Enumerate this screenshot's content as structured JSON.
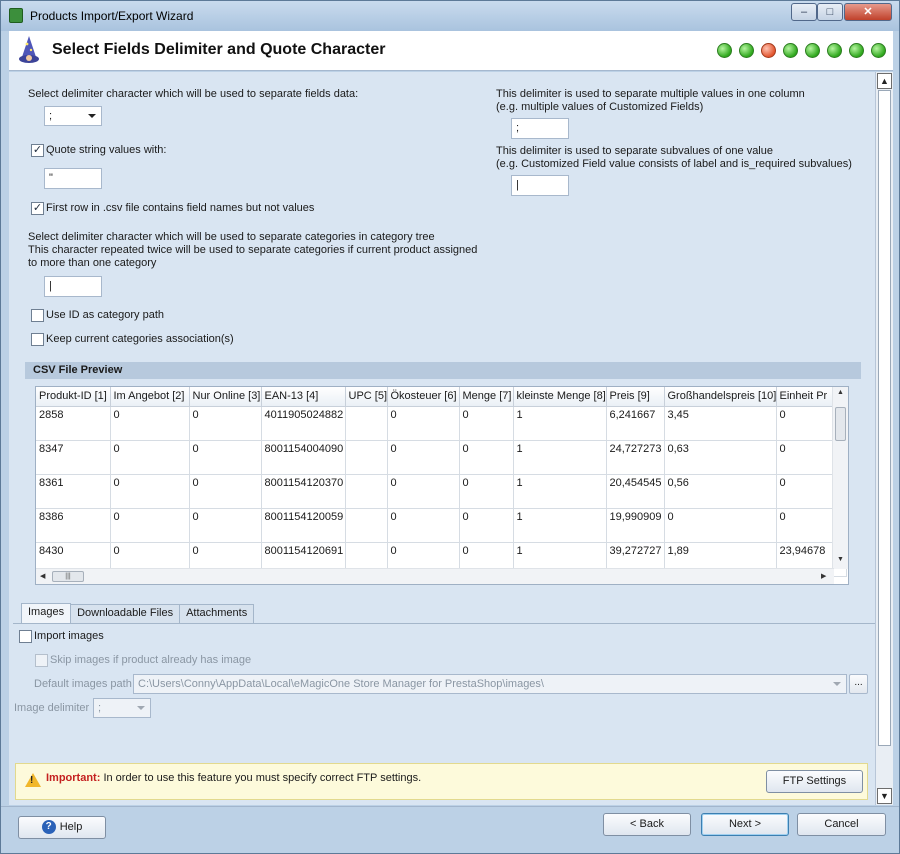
{
  "window": {
    "title": "Products Import/Export Wizard",
    "minimize_glyph": "–",
    "maximize_glyph": "□",
    "close_glyph": "✕"
  },
  "header": {
    "title": "Select Fields Delimiter and Quote Character",
    "steps_total": 8,
    "current_step": 3,
    "step_colors": {
      "done": "#2fa81d",
      "current": "#e2552e"
    }
  },
  "delimiter": {
    "label": "Select delimiter character which will be used to separate fields data:",
    "value": ";"
  },
  "quote": {
    "checkbox_label": "Quote string values with:",
    "checked": true,
    "value": "\""
  },
  "first_row": {
    "checkbox_label": "First row in .csv file contains field names but not values",
    "checked": true
  },
  "category_delimiter": {
    "line1": "Select delimiter character which will be used to separate categories in category tree",
    "line2": "This character repeated twice will be used to separate categories if current product assigned",
    "line3": "to more than one category",
    "value": "|"
  },
  "use_id": {
    "checkbox_label": "Use ID as category path",
    "checked": false
  },
  "keep_categories": {
    "checkbox_label": "Keep current categories association(s)",
    "checked": false
  },
  "multi_values": {
    "line1": "This delimiter is used to separate multiple values in one column",
    "line2": "(e.g. multiple values of Customized Fields)",
    "value": ";"
  },
  "subvalues": {
    "line1": "This delimiter is used to separate subvalues of one value",
    "line2": "(e.g. Customized Field value consists of label and is_required subvalues)",
    "value": "|"
  },
  "preview": {
    "title": "CSV File Preview",
    "columns": [
      "Produkt-ID [1]",
      "Im Angebot [2]",
      "Nur Online [3]",
      "EAN-13 [4]",
      "UPC [5]",
      "Ökosteuer [6]",
      "Menge [7]",
      "kleinste Menge [8]",
      "Preis [9]",
      "Großhandelspreis [10]",
      "Einheit Pr"
    ],
    "rows": [
      [
        "2858",
        "0",
        "0",
        "4011905024882",
        "",
        "0",
        "0",
        "1",
        "6,241667",
        "3,45",
        "0"
      ],
      [
        "8347",
        "0",
        "0",
        "8001154004090",
        "",
        "0",
        "0",
        "1",
        "24,727273",
        "0,63",
        "0"
      ],
      [
        "8361",
        "0",
        "0",
        "8001154120370",
        "",
        "0",
        "0",
        "1",
        "20,454545",
        "0,56",
        "0"
      ],
      [
        "8386",
        "0",
        "0",
        "8001154120059",
        "",
        "0",
        "0",
        "1",
        "19,990909",
        "0",
        "0"
      ],
      [
        "8430",
        "0",
        "0",
        "8001154120691",
        "",
        "0",
        "0",
        "1",
        "39,272727",
        "1,89",
        "23,94678"
      ]
    ]
  },
  "tabs": [
    "Images",
    "Downloadable Files",
    "Attachments"
  ],
  "images": {
    "import_label": "Import images",
    "skip_label": "Skip images if product already has image",
    "path_label": "Default images path",
    "path_value": "C:\\Users\\Conny\\AppData\\Local\\eMagicOne Store Manager for PrestaShop\\images\\",
    "browse_label": "...",
    "delimiter_label": "Image delimiter",
    "delimiter_value": ";"
  },
  "notice": {
    "important": "Important:",
    "message": "In order to use this feature you must specify correct FTP settings.",
    "ftp_button": "FTP Settings"
  },
  "footer": {
    "help": "Help",
    "back": "< Back",
    "next": "Next >",
    "cancel": "Cancel"
  }
}
